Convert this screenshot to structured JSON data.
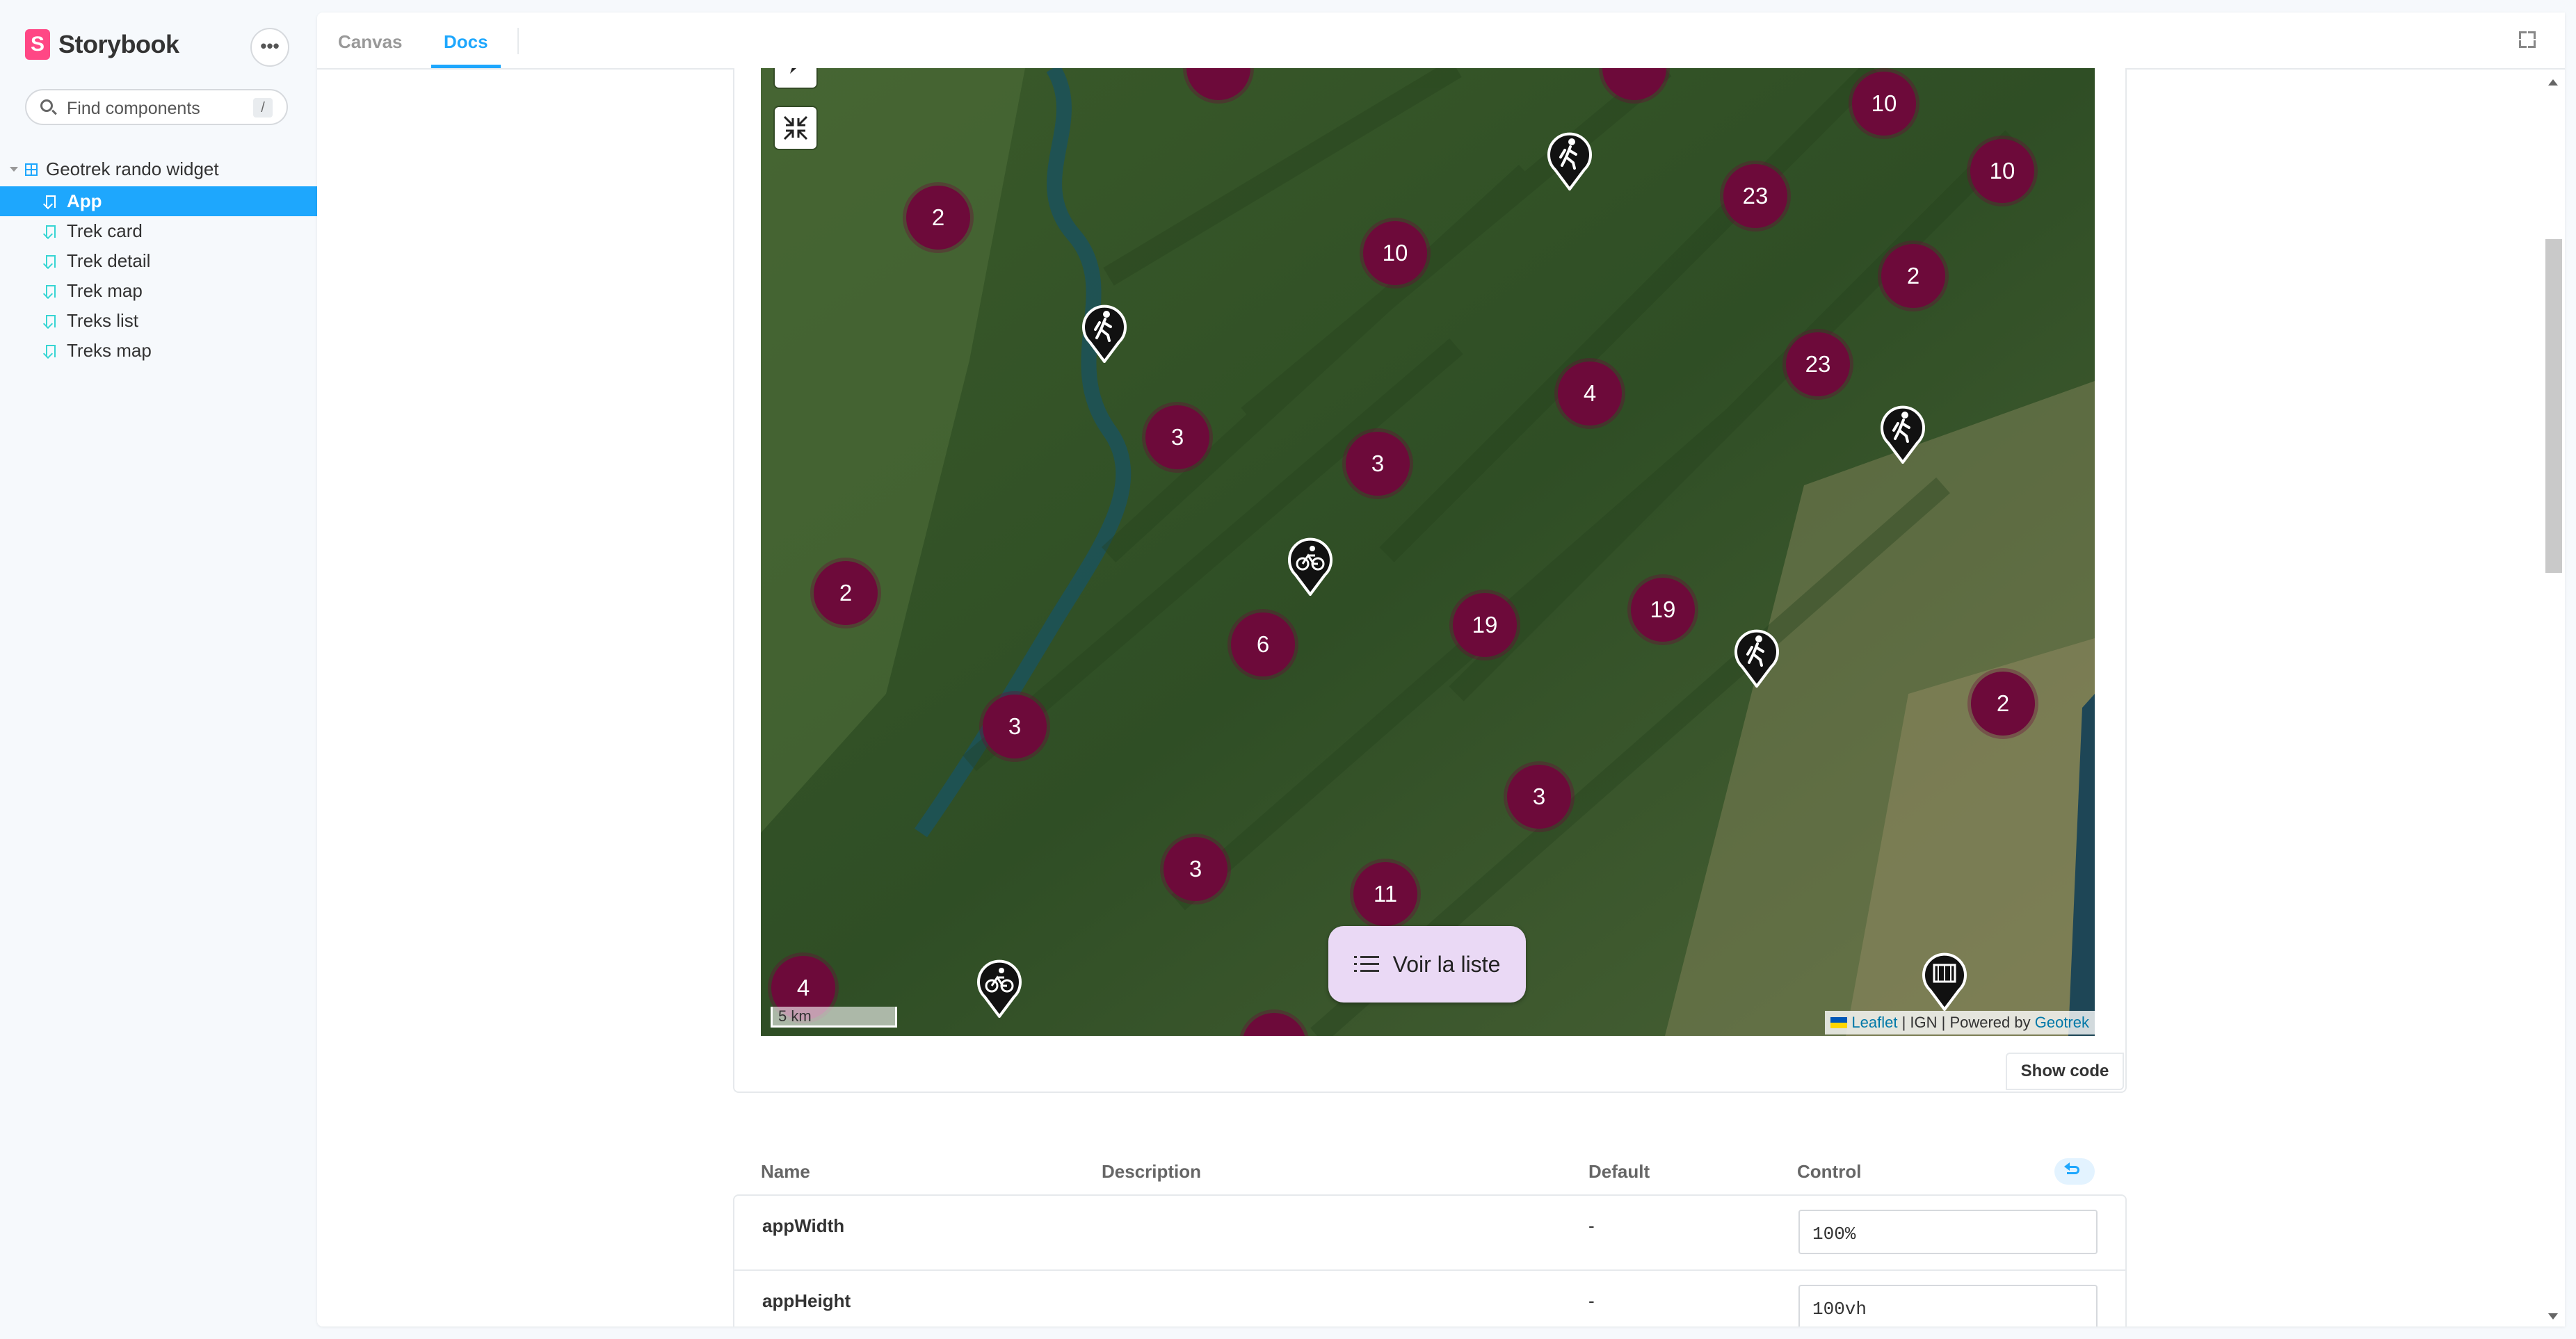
{
  "sidebar": {
    "brand": "Storybook",
    "brand_logo": "S",
    "menu_icon": "•••",
    "search": {
      "placeholder": "Find components",
      "shortcut": "/"
    },
    "root": {
      "label": "Geotrek rando widget"
    },
    "items": [
      {
        "label": "App",
        "active": true
      },
      {
        "label": "Trek card"
      },
      {
        "label": "Trek detail"
      },
      {
        "label": "Trek map"
      },
      {
        "label": "Treks list"
      },
      {
        "label": "Treks map"
      }
    ]
  },
  "toolbar": {
    "tabs": [
      {
        "label": "Canvas"
      },
      {
        "label": "Docs",
        "active": true
      }
    ],
    "fullscreen_icon": "fullscreen-icon"
  },
  "map": {
    "clusters": [
      {
        "count": "2"
      },
      {
        "count": "10"
      },
      {
        "count": "10"
      },
      {
        "count": "23"
      },
      {
        "count": "10"
      },
      {
        "count": "2"
      },
      {
        "count": "23"
      },
      {
        "count": "4"
      },
      {
        "count": "3"
      },
      {
        "count": "3"
      },
      {
        "count": "2"
      },
      {
        "count": "6"
      },
      {
        "count": "19"
      },
      {
        "count": "19"
      },
      {
        "count": "3"
      },
      {
        "count": "2"
      },
      {
        "count": "3"
      },
      {
        "count": "3"
      },
      {
        "count": "11"
      },
      {
        "count": "4"
      }
    ],
    "pins": [
      {
        "type": "hiking-icon"
      },
      {
        "type": "hiking-icon"
      },
      {
        "type": "hiking-icon"
      },
      {
        "type": "cycling-icon"
      },
      {
        "type": "hiking-icon"
      },
      {
        "type": "cycling-icon"
      },
      {
        "type": "other-activity-icon"
      }
    ],
    "voir_label": "Voir la liste",
    "scale_label": "5 km",
    "attribution": {
      "leaflet": "Leaflet",
      "ign": " | IGN | Powered by ",
      "geotrek": "Geotrek"
    },
    "colors": {
      "cluster": "#6d0a3a",
      "button": "#ead9f5"
    }
  },
  "story": {
    "show_code": "Show code"
  },
  "args": {
    "headers": {
      "name": "Name",
      "description": "Description",
      "default": "Default",
      "control": "Control"
    },
    "rows": [
      {
        "name": "appWidth",
        "default": "-",
        "value": "100%"
      },
      {
        "name": "appHeight",
        "default": "-",
        "value": "100vh"
      }
    ]
  },
  "accent": "#1ea7fd"
}
